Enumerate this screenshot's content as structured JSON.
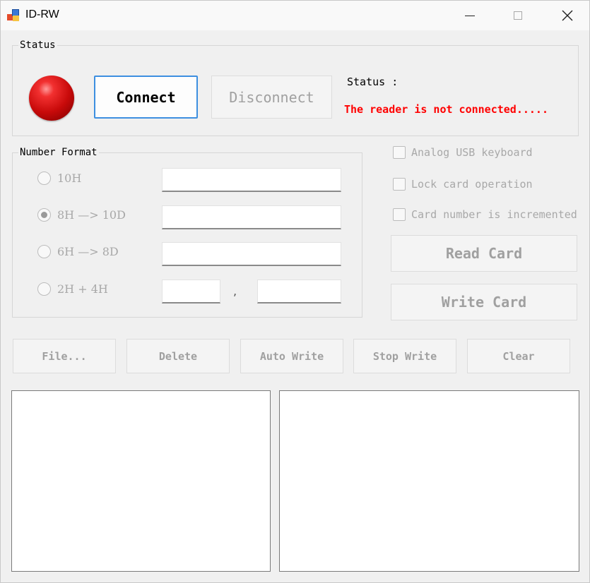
{
  "window": {
    "title": "ID-RW",
    "minimize_label": "—",
    "maximize_label": "□",
    "close_label": "✕"
  },
  "status_group": {
    "legend": "Status",
    "connect_label": "Connect",
    "disconnect_label": "Disconnect",
    "status_label": "Status :",
    "status_message": "The reader is not connected.....",
    "status_message_color": "#ff0000",
    "led_color": "#d40000"
  },
  "number_format": {
    "legend": "Number Format",
    "options": [
      {
        "label": "10H",
        "selected": false
      },
      {
        "label": "8H —> 10D",
        "selected": true
      },
      {
        "label": "6H —> 8D",
        "selected": false
      },
      {
        "label": "2H + 4H",
        "selected": false
      }
    ],
    "fields": {
      "f10h": "",
      "f8h10d": "",
      "f6h8d": "",
      "f2h": "",
      "f4h": "",
      "separator": ","
    }
  },
  "options": {
    "analog_usb_keyboard": "Analog USB keyboard",
    "lock_card_operation": "Lock card operation",
    "card_number_incremented": "Card number is incremented"
  },
  "actions": {
    "read_card": "Read Card",
    "write_card": "Write Card",
    "file": "File...",
    "delete": "Delete",
    "auto_write": "Auto Write",
    "stop_write": "Stop Write",
    "clear": "Clear"
  },
  "colors": {
    "accent_border": "#3d8fe0",
    "disabled_text": "#a0a0a0",
    "window_bg": "#f0f0f0"
  }
}
